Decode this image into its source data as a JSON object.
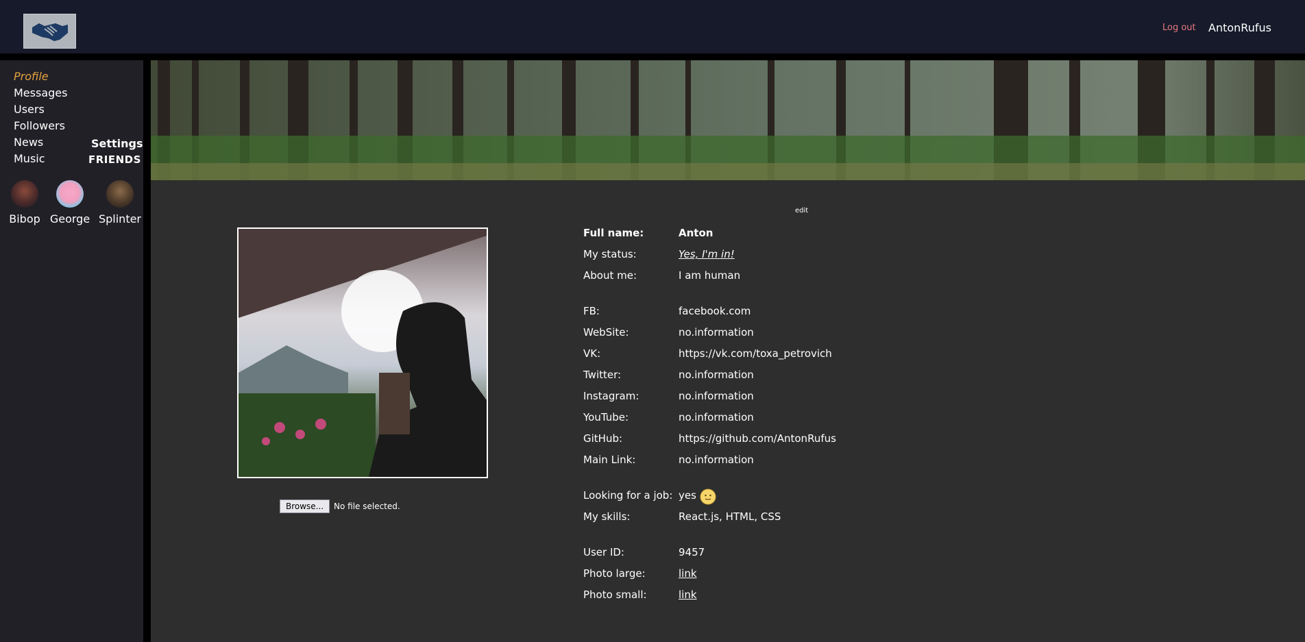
{
  "header": {
    "logout_label": "Log out",
    "username": "AntonRufus"
  },
  "sidebar": {
    "items": [
      {
        "label": "Profile"
      },
      {
        "label": "Messages"
      },
      {
        "label": "Users"
      },
      {
        "label": "Followers"
      },
      {
        "label": "News"
      },
      {
        "label": "Music"
      }
    ],
    "settings_label": "Settings",
    "friends_title": "FRIENDS",
    "friends": [
      {
        "name": "Bibop"
      },
      {
        "name": "George"
      },
      {
        "name": "Splinter"
      }
    ]
  },
  "profile": {
    "edit_label": "edit",
    "browse_label": "Browse...",
    "no_file_text": "No file selected.",
    "full_name_label": "Full name:",
    "full_name": "Anton",
    "status_label": "My status:",
    "status": "Yes, I'm in!",
    "about_label": "About me:",
    "about": "I am human",
    "contacts": [
      {
        "label": "FB:",
        "value": "facebook.com"
      },
      {
        "label": "WebSite:",
        "value": "no.information"
      },
      {
        "label": "VK:",
        "value": "https://vk.com/toxa_petrovich"
      },
      {
        "label": "Twitter:",
        "value": "no.information"
      },
      {
        "label": "Instagram:",
        "value": "no.information"
      },
      {
        "label": "YouTube:",
        "value": "no.information"
      },
      {
        "label": "GitHub:",
        "value": "https://github.com/AntonRufus"
      },
      {
        "label": "Main Link:",
        "value": "no.information"
      }
    ],
    "job_label": "Looking for a job:",
    "job_value": "yes",
    "skills_label": "My skills:",
    "skills_value": "React.js, HTML, CSS",
    "user_id_label": "User ID:",
    "user_id": "9457",
    "photo_large_label": "Photo large:",
    "photo_large_value": "link",
    "photo_small_label": "Photo small:",
    "photo_small_value": "link"
  },
  "colors": {
    "header_bg": "#161a2a",
    "sidebar_bg": "#222027",
    "main_bg": "#2e2e2e",
    "active_nav": "#e3a33f",
    "logout": "#e6797e"
  }
}
